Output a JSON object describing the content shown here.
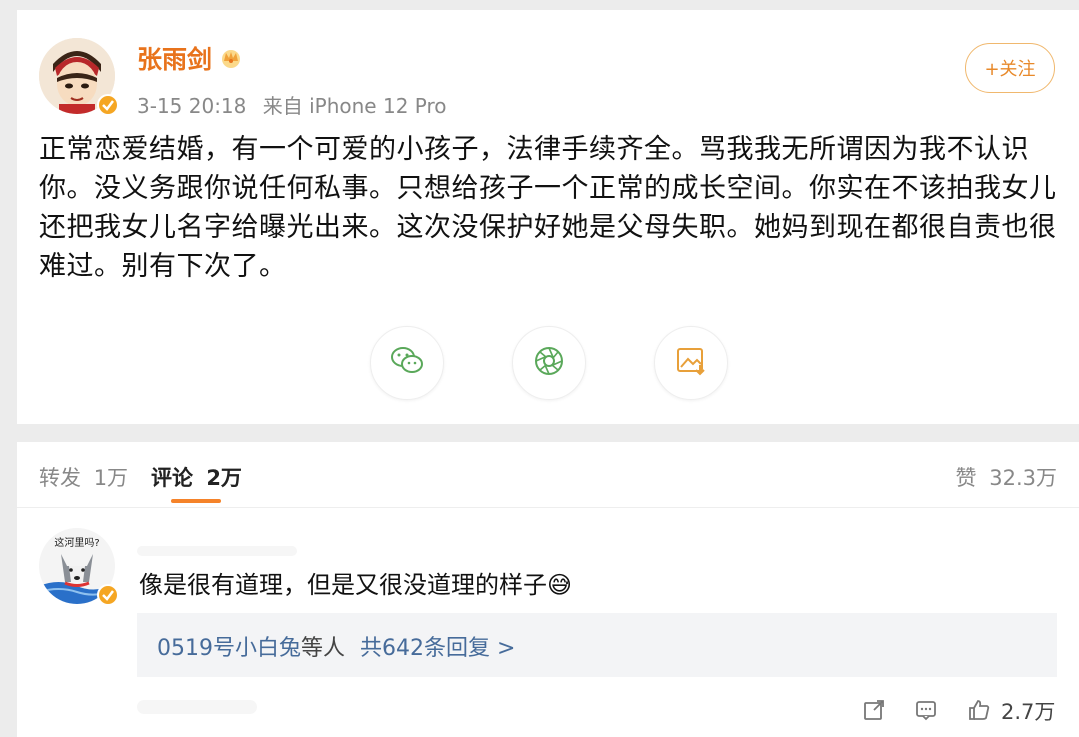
{
  "post": {
    "username": "张雨剑",
    "timestamp": "3-15 20:18",
    "source": "来自 iPhone 12 Pro",
    "follow_label": "+关注",
    "content": "正常恋爱结婚，有一个可爱的小孩子，法律手续齐全。骂我我无所谓因为我不认识你。没义务跟你说任何私事。只想给孩子一个正常的成长空间。你实在不该拍我女儿还把我女儿名字给曝光出来。这次没保护好她是父母失职。她妈到现在都很自责也很难过。别有下次了。",
    "share_icons": [
      "wechat-icon",
      "moments-icon",
      "save-image-icon"
    ],
    "colors": {
      "username": "#e8731c",
      "accent": "#f5832a",
      "follow_border": "#f0b86e"
    }
  },
  "tabs": {
    "repost_label": "转发",
    "repost_count": "1万",
    "comment_label": "评论",
    "comment_count": "2万",
    "like_label": "赞",
    "like_count": "32.3万"
  },
  "comment": {
    "avatar_text": "这河里吗?",
    "text": "像是很有道理，但是又很没道理的样子😅",
    "reply_users": "0519号小白兔",
    "reply_mid": "等人",
    "reply_count": "共642条回复 >",
    "like_count": "2.7万",
    "colors": {
      "link": "#466b9a",
      "reply_bg": "#f3f4f6"
    }
  }
}
